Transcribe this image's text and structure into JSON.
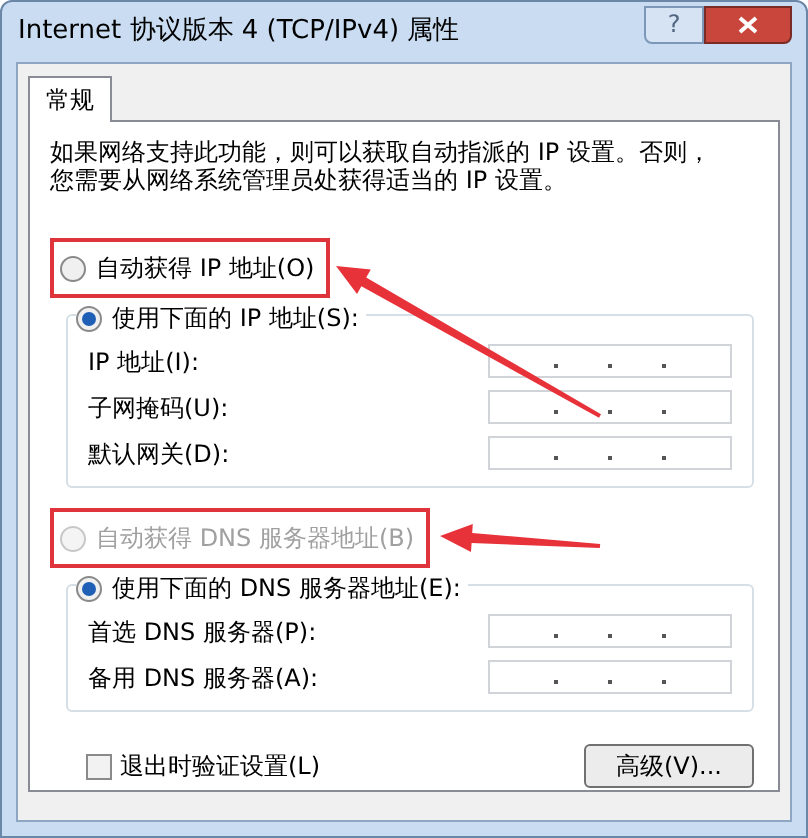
{
  "window": {
    "title": "Internet 协议版本 4 (TCP/IPv4) 属性",
    "help_button": "?"
  },
  "tabs": [
    {
      "label": "常规",
      "selected": true
    }
  ],
  "description": "如果网络支持此功能，则可以获取自动指派的 IP 设置。否则，您需要从网络系统管理员处获得适当的 IP 设置。",
  "ip_settings": {
    "auto_option": {
      "label": "自动获得 IP 地址(O)",
      "selected": false,
      "disabled": false,
      "highlighted": true
    },
    "manual_option": {
      "label": "使用下面的 IP 地址(S):",
      "selected": true,
      "disabled": false
    },
    "fields": [
      {
        "label": "IP 地址(I):"
      },
      {
        "label": "子网掩码(U):"
      },
      {
        "label": "默认网关(D):"
      }
    ]
  },
  "dns_settings": {
    "auto_option": {
      "label": "自动获得 DNS 服务器地址(B)",
      "selected": false,
      "disabled": true,
      "highlighted": true
    },
    "manual_option": {
      "label": "使用下面的 DNS 服务器地址(E):",
      "selected": true,
      "disabled": false
    },
    "fields": [
      {
        "label": "首选 DNS 服务器(P):"
      },
      {
        "label": "备用 DNS 服务器(A):"
      }
    ]
  },
  "validate_on_exit": {
    "label": "退出时验证设置(L)",
    "checked": false
  },
  "advanced_button": "高级(V)..."
}
